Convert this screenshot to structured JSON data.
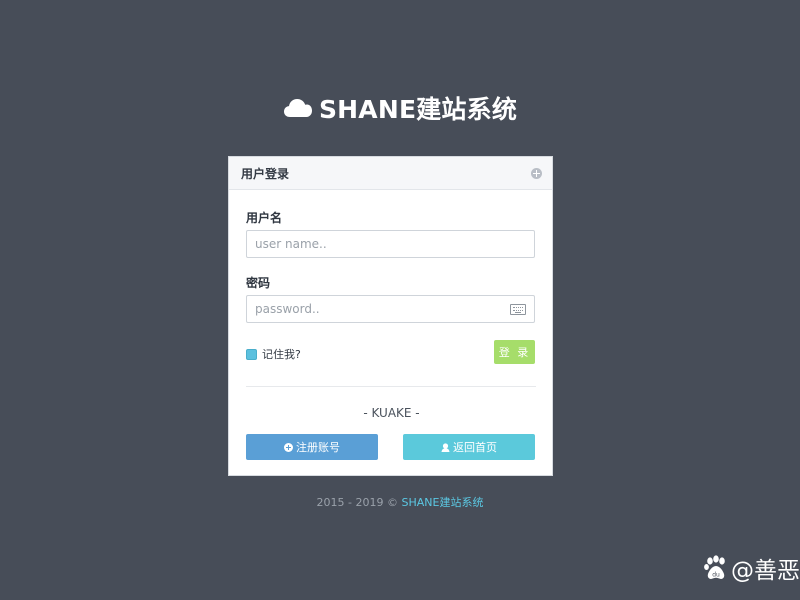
{
  "brand": {
    "icon": "cloud-icon",
    "title": "SHANE建站系统"
  },
  "login_panel": {
    "header_title": "用户登录",
    "header_icon": "plus-circle-icon",
    "username": {
      "label": "用户名",
      "placeholder": "user name..",
      "value": ""
    },
    "password": {
      "label": "密码",
      "placeholder": "password..",
      "value": "",
      "icon": "keyboard-icon"
    },
    "remember_me": {
      "label": "记住我?",
      "checked": true
    },
    "login_button": "登 录",
    "separator_text": "- KUAKE -",
    "register_button": {
      "label": "注册账号",
      "icon": "plus-circle-icon"
    },
    "home_button": {
      "label": "返回首页",
      "icon": "user-icon"
    }
  },
  "footer": {
    "copyright": "2015 - 2019 © ",
    "link_text": "SHANE建站系统"
  },
  "watermark": {
    "icon": "baidu-paw-icon",
    "text": "@善恶"
  },
  "colors": {
    "background": "#474d58",
    "login_button": "#a6dd6a",
    "register_button": "#5a9fd6",
    "home_button": "#5bc9db",
    "footer_link": "#5bc8e3",
    "checkbox": "#5bc0de"
  }
}
